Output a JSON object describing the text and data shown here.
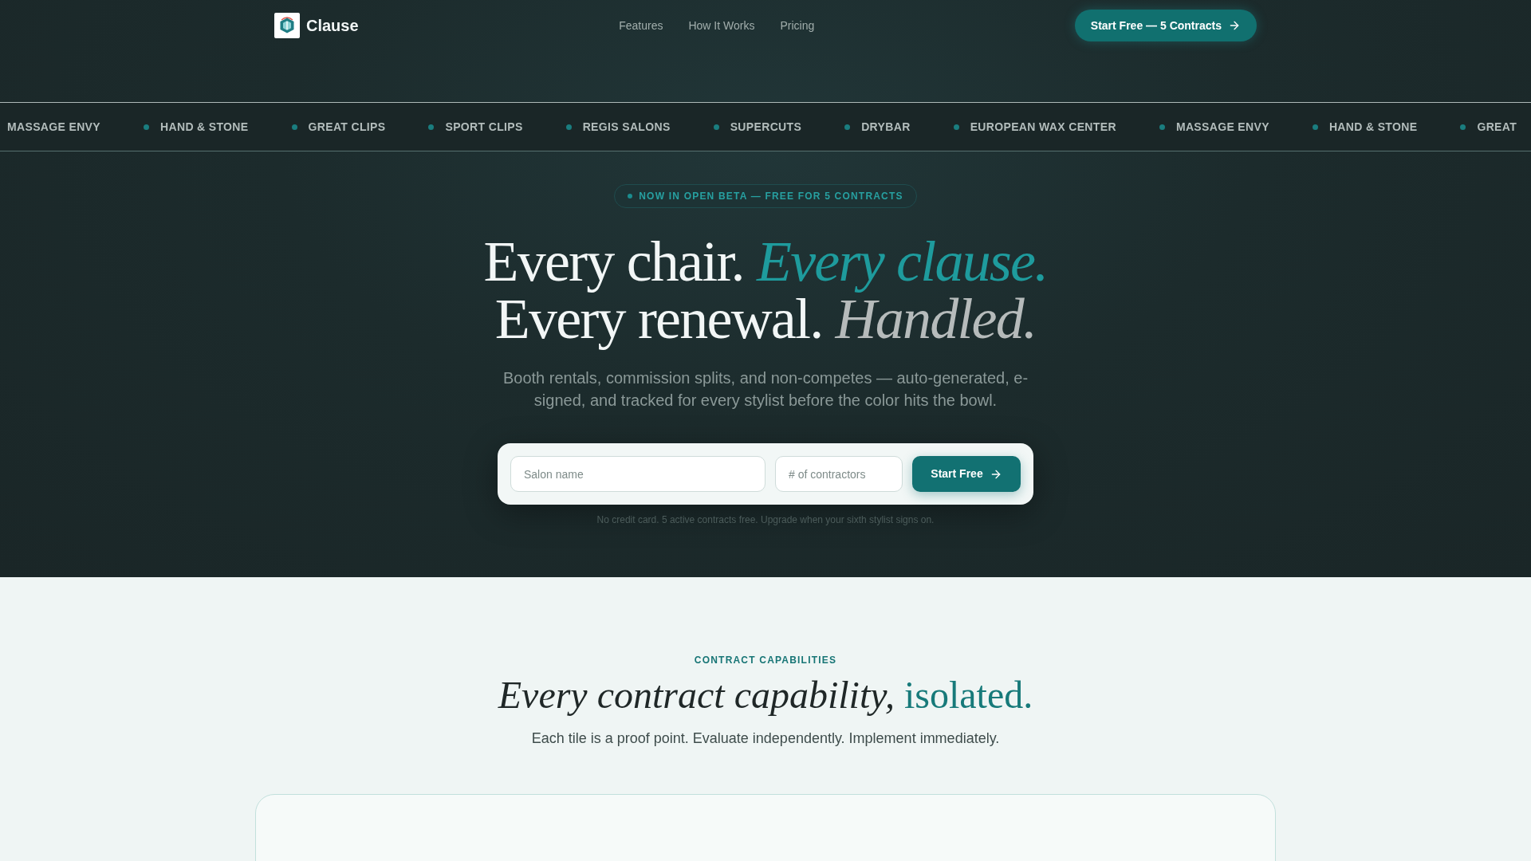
{
  "nav": {
    "brand": "Clause",
    "links": [
      {
        "label": "Features"
      },
      {
        "label": "How It Works"
      },
      {
        "label": "Pricing"
      }
    ],
    "cta": "Start Free — 5 Contracts"
  },
  "marquee": [
    "MASSAGE ENVY",
    "HAND & STONE",
    "GREAT CLIPS",
    "SPORT CLIPS",
    "REGIS SALONS",
    "SUPERCUTS",
    "DRYBAR",
    "EUROPEAN WAX CENTER",
    "MASSAGE ENVY",
    "HAND & STONE",
    "GREAT"
  ],
  "hero": {
    "badge": "NOW IN OPEN BETA — FREE FOR 5 CONTRACTS",
    "headline": [
      [
        {
          "text": "Every chair.",
          "kind": "plain"
        },
        {
          "text": "Every clause.",
          "kind": "accent"
        }
      ],
      [
        {
          "text": "Every renewal.",
          "kind": "plain"
        },
        {
          "text": "Handled.",
          "kind": "muted"
        }
      ]
    ],
    "subtitle": "Booth rentals, commission splits, and non-competes — auto-generated, e-signed, and tracked for every stylist before the color hits the bowl.",
    "form": {
      "fields": [
        {
          "placeholder": "Salon name",
          "kind": "wide"
        },
        {
          "placeholder": "# of contractors",
          "kind": "narrow"
        }
      ],
      "button": "Start Free"
    },
    "note": "No credit card. 5 active contracts free. Upgrade when your sixth stylist signs on."
  },
  "capabilities": {
    "eyebrow": "CONTRACT CAPABILITIES",
    "heading": [
      {
        "text": "Every contract capability,",
        "kind": "italic"
      },
      {
        "text": "isolated.",
        "kind": "accent"
      }
    ],
    "subtitle": "Each tile is a proof point. Evaluate independently. Implement immediately."
  }
}
